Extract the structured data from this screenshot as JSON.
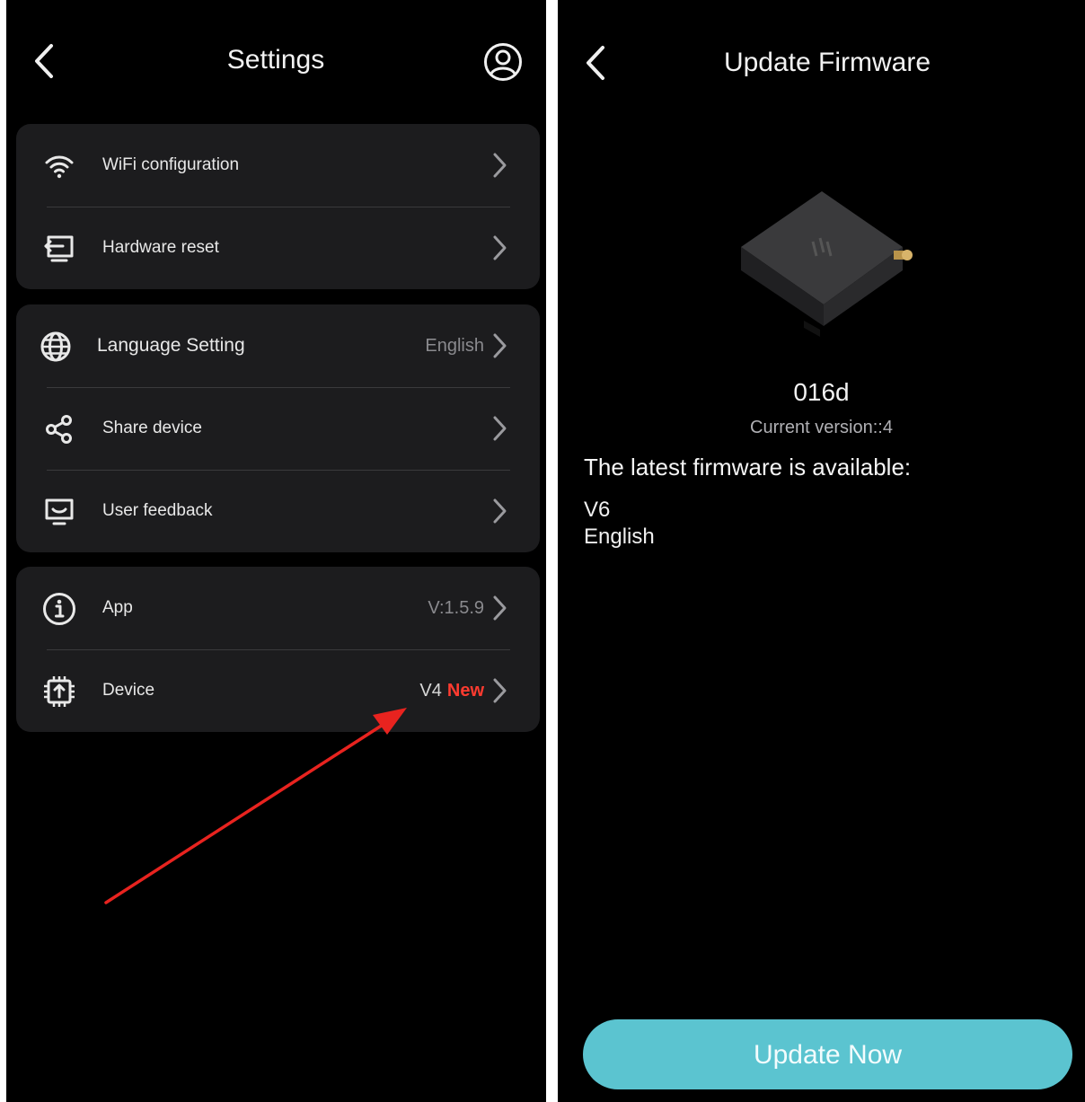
{
  "settings": {
    "title": "Settings",
    "groups": [
      {
        "items": [
          {
            "label": "WiFi configuration",
            "icon": "wifi-icon"
          },
          {
            "label": "Hardware reset",
            "icon": "reset-icon"
          }
        ]
      },
      {
        "items": [
          {
            "label": "Language Setting",
            "icon": "globe-icon",
            "value": "English"
          },
          {
            "label": "Share device",
            "icon": "share-icon"
          },
          {
            "label": "User feedback",
            "icon": "feedback-icon"
          }
        ]
      },
      {
        "items": [
          {
            "label": "App",
            "icon": "info-icon",
            "value": "V:1.5.9"
          },
          {
            "label": "Device",
            "icon": "chip-upload-icon",
            "version": "V4",
            "badge": "New"
          }
        ]
      }
    ],
    "annotation_color": "#e8231f"
  },
  "firmware": {
    "title": "Update Firmware",
    "device_name": "016d",
    "current_version": "Current version::4",
    "available_heading": "The latest firmware is available:",
    "latest_version": "V6",
    "latest_language": "English",
    "update_button": "Update Now",
    "button_color": "#5bc4d0"
  }
}
